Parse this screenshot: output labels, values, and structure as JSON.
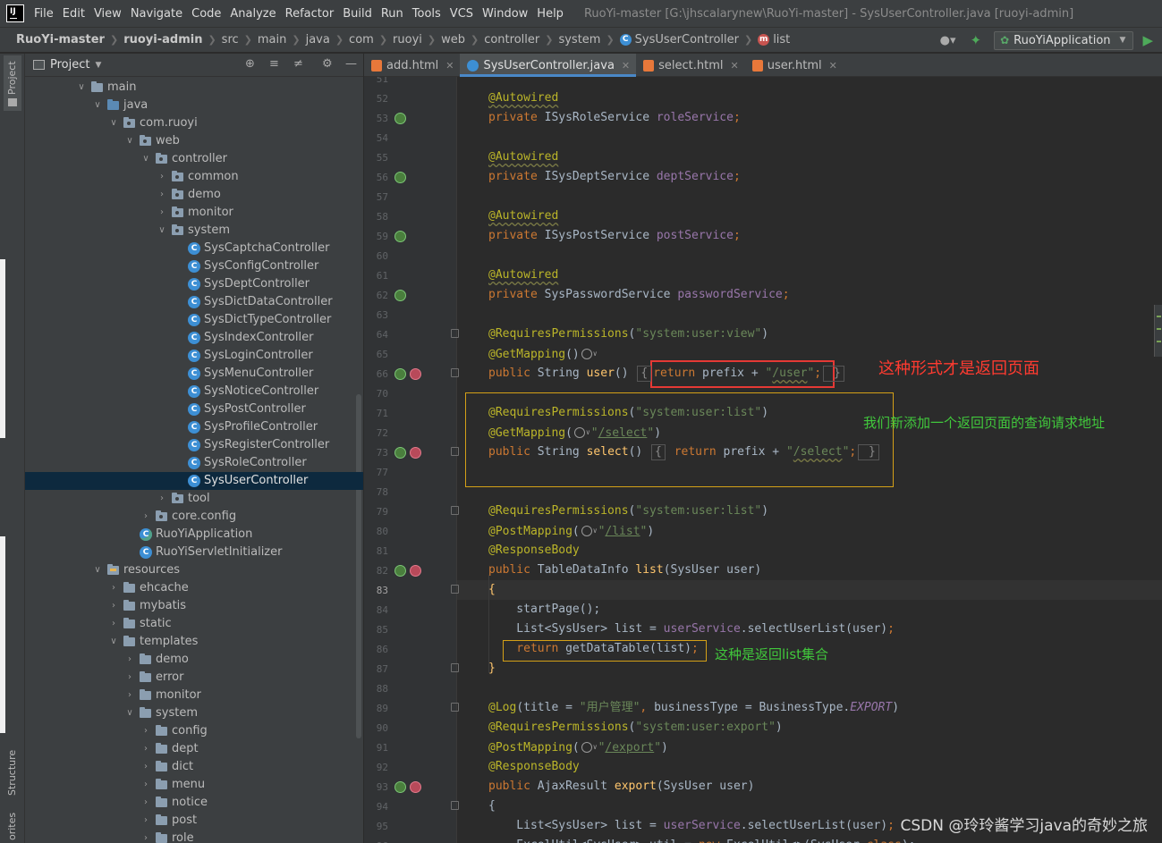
{
  "menubar": {
    "items": [
      "File",
      "Edit",
      "View",
      "Navigate",
      "Code",
      "Analyze",
      "Refactor",
      "Build",
      "Run",
      "Tools",
      "VCS",
      "Window",
      "Help"
    ],
    "window_title": "RuoYi-master [G:\\jhscalarynew\\RuoYi-master] - SysUserController.java [ruoyi-admin]"
  },
  "navbar": {
    "crumbs": [
      "RuoYi-master",
      "ruoyi-admin",
      "src",
      "main",
      "java",
      "com",
      "ruoyi",
      "web",
      "controller",
      "system",
      "SysUserController",
      "list"
    ],
    "run_config": "RuoYiApplication"
  },
  "stripe": {
    "project": "Project",
    "structure": "Structure",
    "favorites": "orites"
  },
  "project_panel": {
    "title": "Project",
    "tree": [
      {
        "label": "main",
        "depth": 0,
        "kind": "folder",
        "expanded": true
      },
      {
        "label": "java",
        "depth": 1,
        "kind": "src",
        "expanded": true
      },
      {
        "label": "com.ruoyi",
        "depth": 2,
        "kind": "pkg",
        "expanded": true
      },
      {
        "label": "web",
        "depth": 3,
        "kind": "pkg",
        "expanded": true
      },
      {
        "label": "controller",
        "depth": 4,
        "kind": "pkg",
        "expanded": true
      },
      {
        "label": "common",
        "depth": 5,
        "kind": "pkg",
        "expanded": false
      },
      {
        "label": "demo",
        "depth": 5,
        "kind": "pkg",
        "expanded": false
      },
      {
        "label": "monitor",
        "depth": 5,
        "kind": "pkg",
        "expanded": false
      },
      {
        "label": "system",
        "depth": 5,
        "kind": "pkg",
        "expanded": true
      },
      {
        "label": "SysCaptchaController",
        "depth": 6,
        "kind": "class"
      },
      {
        "label": "SysConfigController",
        "depth": 6,
        "kind": "class"
      },
      {
        "label": "SysDeptController",
        "depth": 6,
        "kind": "class"
      },
      {
        "label": "SysDictDataController",
        "depth": 6,
        "kind": "class"
      },
      {
        "label": "SysDictTypeController",
        "depth": 6,
        "kind": "class"
      },
      {
        "label": "SysIndexController",
        "depth": 6,
        "kind": "class"
      },
      {
        "label": "SysLoginController",
        "depth": 6,
        "kind": "class"
      },
      {
        "label": "SysMenuController",
        "depth": 6,
        "kind": "class"
      },
      {
        "label": "SysNoticeController",
        "depth": 6,
        "kind": "class"
      },
      {
        "label": "SysPostController",
        "depth": 6,
        "kind": "class"
      },
      {
        "label": "SysProfileController",
        "depth": 6,
        "kind": "class"
      },
      {
        "label": "SysRegisterController",
        "depth": 6,
        "kind": "class"
      },
      {
        "label": "SysRoleController",
        "depth": 6,
        "kind": "class"
      },
      {
        "label": "SysUserController",
        "depth": 6,
        "kind": "class",
        "selected": true
      },
      {
        "label": "tool",
        "depth": 5,
        "kind": "pkg",
        "expanded": false
      },
      {
        "label": "core.config",
        "depth": 4,
        "kind": "pkg",
        "expanded": false
      },
      {
        "label": "RuoYiApplication",
        "depth": 3,
        "kind": "spring"
      },
      {
        "label": "RuoYiServletInitializer",
        "depth": 3,
        "kind": "class"
      },
      {
        "label": "resources",
        "depth": 1,
        "kind": "res",
        "expanded": true
      },
      {
        "label": "ehcache",
        "depth": 2,
        "kind": "folder",
        "expanded": false
      },
      {
        "label": "mybatis",
        "depth": 2,
        "kind": "folder",
        "expanded": false
      },
      {
        "label": "static",
        "depth": 2,
        "kind": "folder",
        "expanded": false
      },
      {
        "label": "templates",
        "depth": 2,
        "kind": "folder",
        "expanded": true
      },
      {
        "label": "demo",
        "depth": 3,
        "kind": "folder",
        "expanded": false
      },
      {
        "label": "error",
        "depth": 3,
        "kind": "folder",
        "expanded": false
      },
      {
        "label": "monitor",
        "depth": 3,
        "kind": "folder",
        "expanded": false
      },
      {
        "label": "system",
        "depth": 3,
        "kind": "folder",
        "expanded": true
      },
      {
        "label": "config",
        "depth": 4,
        "kind": "folder",
        "expanded": false
      },
      {
        "label": "dept",
        "depth": 4,
        "kind": "folder",
        "expanded": false
      },
      {
        "label": "dict",
        "depth": 4,
        "kind": "folder",
        "expanded": false
      },
      {
        "label": "menu",
        "depth": 4,
        "kind": "folder",
        "expanded": false
      },
      {
        "label": "notice",
        "depth": 4,
        "kind": "folder",
        "expanded": false
      },
      {
        "label": "post",
        "depth": 4,
        "kind": "folder",
        "expanded": false
      },
      {
        "label": "role",
        "depth": 4,
        "kind": "folder",
        "expanded": false
      }
    ]
  },
  "tabs": [
    {
      "label": "add.html",
      "type": "html",
      "active": false
    },
    {
      "label": "SysUserController.java",
      "type": "java",
      "active": true
    },
    {
      "label": "select.html",
      "type": "html",
      "active": false
    },
    {
      "label": "user.html",
      "type": "html",
      "active": false
    }
  ],
  "editor": {
    "current_line": "83",
    "lines": [
      {
        "num": "51",
        "markers": [],
        "segs": []
      },
      {
        "num": "52",
        "markers": [],
        "segs": [
          {
            "t": "@Autowired",
            "c": "ann u-wavy"
          }
        ]
      },
      {
        "num": "53",
        "markers": [
          "run"
        ],
        "segs": [
          {
            "t": "private ",
            "c": "kw"
          },
          {
            "t": "ISysRoleService ",
            "c": "plain"
          },
          {
            "t": "roleService",
            "c": "fld"
          },
          {
            "t": ";",
            "c": "kw"
          }
        ]
      },
      {
        "num": "54",
        "markers": [],
        "segs": []
      },
      {
        "num": "55",
        "markers": [],
        "segs": [
          {
            "t": "@Autowired",
            "c": "ann u-wavy"
          }
        ]
      },
      {
        "num": "56",
        "markers": [
          "run"
        ],
        "segs": [
          {
            "t": "private ",
            "c": "kw"
          },
          {
            "t": "ISysDeptService ",
            "c": "plain"
          },
          {
            "t": "deptService",
            "c": "fld"
          },
          {
            "t": ";",
            "c": "kw"
          }
        ]
      },
      {
        "num": "57",
        "markers": [],
        "segs": []
      },
      {
        "num": "58",
        "markers": [],
        "segs": [
          {
            "t": "@Autowired",
            "c": "ann u-wavy"
          }
        ]
      },
      {
        "num": "59",
        "markers": [
          "run"
        ],
        "segs": [
          {
            "t": "private ",
            "c": "kw"
          },
          {
            "t": "ISysPostService ",
            "c": "plain"
          },
          {
            "t": "postService",
            "c": "fld"
          },
          {
            "t": ";",
            "c": "kw"
          }
        ]
      },
      {
        "num": "60",
        "markers": [],
        "segs": []
      },
      {
        "num": "61",
        "markers": [],
        "segs": [
          {
            "t": "@Autowired",
            "c": "ann u-wavy"
          }
        ]
      },
      {
        "num": "62",
        "markers": [
          "run"
        ],
        "segs": [
          {
            "t": "private ",
            "c": "kw"
          },
          {
            "t": "SysPasswordService ",
            "c": "plain"
          },
          {
            "t": "passwordService",
            "c": "fld"
          },
          {
            "t": ";",
            "c": "kw"
          }
        ]
      },
      {
        "num": "63",
        "markers": [],
        "segs": []
      },
      {
        "num": "64",
        "markers": [
          "fold"
        ],
        "segs": [
          {
            "t": "@RequiresPermissions",
            "c": "ann"
          },
          {
            "t": "(",
            "c": "plain"
          },
          {
            "t": "\"system:user:view\"",
            "c": "str"
          },
          {
            "t": ")",
            "c": "plain"
          }
        ]
      },
      {
        "num": "65",
        "markers": [],
        "segs": [
          {
            "t": "@GetMapping",
            "c": "ann"
          },
          {
            "t": "()",
            "c": "plain"
          },
          {
            "t": "globe",
            "c": "globe"
          }
        ]
      },
      {
        "num": "66",
        "markers": [
          "run",
          "web",
          "fold"
        ],
        "segs": [
          {
            "t": "public ",
            "c": "kw"
          },
          {
            "t": "String ",
            "c": "plain"
          },
          {
            "t": "user",
            "c": "fn"
          },
          {
            "t": "() ",
            "c": "plain"
          },
          {
            "t": "{",
            "c": "foldbox"
          },
          {
            "t": "return ",
            "c": "kw"
          },
          {
            "t": "prefix ",
            "c": "plain"
          },
          {
            "t": "+ ",
            "c": "plain"
          },
          {
            "t": "\"",
            "c": "str"
          },
          {
            "t": "/user",
            "c": "str u-wavy"
          },
          {
            "t": "\"",
            "c": "str"
          },
          {
            "t": ";",
            "c": "kw"
          },
          {
            "t": " }",
            "c": "foldbox"
          }
        ]
      },
      {
        "num": "70",
        "markers": [],
        "segs": []
      },
      {
        "num": "71",
        "markers": [],
        "segs": [
          {
            "t": "@RequiresPermissions",
            "c": "ann"
          },
          {
            "t": "(",
            "c": "plain"
          },
          {
            "t": "\"system:user:list\"",
            "c": "str"
          },
          {
            "t": ")",
            "c": "plain"
          }
        ]
      },
      {
        "num": "72",
        "markers": [],
        "segs": [
          {
            "t": "@GetMapping",
            "c": "ann"
          },
          {
            "t": "(",
            "c": "plain"
          },
          {
            "t": "globe",
            "c": "globe"
          },
          {
            "t": "\"",
            "c": "str"
          },
          {
            "t": "/select",
            "c": "str u-link"
          },
          {
            "t": "\"",
            "c": "str"
          },
          {
            "t": ")",
            "c": "plain"
          }
        ]
      },
      {
        "num": "73",
        "markers": [
          "run",
          "web",
          "fold"
        ],
        "segs": [
          {
            "t": "public ",
            "c": "kw"
          },
          {
            "t": "String ",
            "c": "plain"
          },
          {
            "t": "select",
            "c": "fn"
          },
          {
            "t": "() ",
            "c": "plain"
          },
          {
            "t": "{",
            "c": "foldbox"
          },
          {
            "t": " return ",
            "c": "kw"
          },
          {
            "t": "prefix ",
            "c": "plain"
          },
          {
            "t": "+ ",
            "c": "plain"
          },
          {
            "t": "\"",
            "c": "str"
          },
          {
            "t": "/select",
            "c": "str u-wavy"
          },
          {
            "t": "\"",
            "c": "str"
          },
          {
            "t": ";",
            "c": "kw"
          },
          {
            "t": " }",
            "c": "foldbox"
          }
        ]
      },
      {
        "num": "77",
        "markers": [],
        "segs": []
      },
      {
        "num": "78",
        "markers": [],
        "segs": []
      },
      {
        "num": "79",
        "markers": [
          "fold"
        ],
        "segs": [
          {
            "t": "@RequiresPermissions",
            "c": "ann"
          },
          {
            "t": "(",
            "c": "plain"
          },
          {
            "t": "\"system:user:list\"",
            "c": "str"
          },
          {
            "t": ")",
            "c": "plain"
          }
        ]
      },
      {
        "num": "80",
        "markers": [],
        "segs": [
          {
            "t": "@PostMapping",
            "c": "ann"
          },
          {
            "t": "(",
            "c": "plain"
          },
          {
            "t": "globe",
            "c": "globe"
          },
          {
            "t": "\"",
            "c": "str"
          },
          {
            "t": "/list",
            "c": "str u-link"
          },
          {
            "t": "\"",
            "c": "str"
          },
          {
            "t": ")",
            "c": "plain"
          }
        ]
      },
      {
        "num": "81",
        "markers": [],
        "segs": [
          {
            "t": "@ResponseBody",
            "c": "ann"
          }
        ]
      },
      {
        "num": "82",
        "markers": [
          "run",
          "web"
        ],
        "segs": [
          {
            "t": "public ",
            "c": "kw"
          },
          {
            "t": "TableDataInfo ",
            "c": "plain"
          },
          {
            "t": "list",
            "c": "fn"
          },
          {
            "t": "(SysUser user)",
            "c": "plain"
          }
        ]
      },
      {
        "num": "83",
        "markers": [
          "fold"
        ],
        "segs": [
          {
            "t": "{",
            "c": "fn"
          }
        ]
      },
      {
        "num": "84",
        "markers": [],
        "segs": [
          {
            "t": "    startPage();",
            "c": "plain"
          }
        ]
      },
      {
        "num": "85",
        "markers": [],
        "segs": [
          {
            "t": "    List<SysUser> list = ",
            "c": "plain"
          },
          {
            "t": "userService",
            "c": "fld"
          },
          {
            "t": ".selectUserList(user)",
            "c": "plain"
          },
          {
            "t": ";",
            "c": "kw"
          }
        ]
      },
      {
        "num": "86",
        "markers": [],
        "segs": [
          {
            "t": "    return ",
            "c": "kw"
          },
          {
            "t": "getDataTable(list)",
            "c": "plain"
          },
          {
            "t": ";",
            "c": "kw"
          }
        ]
      },
      {
        "num": "87",
        "markers": [
          "fold"
        ],
        "segs": [
          {
            "t": "}",
            "c": "fn"
          }
        ]
      },
      {
        "num": "88",
        "markers": [],
        "segs": []
      },
      {
        "num": "89",
        "markers": [
          "fold"
        ],
        "segs": [
          {
            "t": "@Log",
            "c": "ann"
          },
          {
            "t": "(title = ",
            "c": "plain"
          },
          {
            "t": "\"用户管理\"",
            "c": "str"
          },
          {
            "t": ", ",
            "c": "kw"
          },
          {
            "t": "businessType = BusinessType.",
            "c": "plain"
          },
          {
            "t": "EXPORT",
            "c": "fld it"
          },
          {
            "t": ")",
            "c": "plain"
          }
        ]
      },
      {
        "num": "90",
        "markers": [],
        "segs": [
          {
            "t": "@RequiresPermissions",
            "c": "ann"
          },
          {
            "t": "(",
            "c": "plain"
          },
          {
            "t": "\"system:user:export\"",
            "c": "str"
          },
          {
            "t": ")",
            "c": "plain"
          }
        ]
      },
      {
        "num": "91",
        "markers": [],
        "segs": [
          {
            "t": "@PostMapping",
            "c": "ann"
          },
          {
            "t": "(",
            "c": "plain"
          },
          {
            "t": "globe",
            "c": "globe"
          },
          {
            "t": "\"",
            "c": "str"
          },
          {
            "t": "/export",
            "c": "str u-link"
          },
          {
            "t": "\"",
            "c": "str"
          },
          {
            "t": ")",
            "c": "plain"
          }
        ]
      },
      {
        "num": "92",
        "markers": [],
        "segs": [
          {
            "t": "@ResponseBody",
            "c": "ann"
          }
        ]
      },
      {
        "num": "93",
        "markers": [
          "run",
          "web"
        ],
        "segs": [
          {
            "t": "public ",
            "c": "kw"
          },
          {
            "t": "AjaxResult ",
            "c": "plain"
          },
          {
            "t": "export",
            "c": "fn"
          },
          {
            "t": "(SysUser user)",
            "c": "plain"
          }
        ]
      },
      {
        "num": "94",
        "markers": [
          "fold"
        ],
        "segs": [
          {
            "t": "{",
            "c": "plain"
          }
        ]
      },
      {
        "num": "95",
        "markers": [],
        "segs": [
          {
            "t": "    List<SysUser> list = ",
            "c": "plain"
          },
          {
            "t": "userService",
            "c": "fld"
          },
          {
            "t": ".selectUserList(user)",
            "c": "plain"
          },
          {
            "t": ";",
            "c": "kw"
          }
        ]
      },
      {
        "num": "96",
        "markers": [],
        "segs": [
          {
            "t": "    ExcelUtil<SysUser> util = ",
            "c": "plain"
          },
          {
            "t": "new ",
            "c": "kw"
          },
          {
            "t": "ExcelUtil<>(SysUser.",
            "c": "plain"
          },
          {
            "t": "class",
            "c": "kw"
          },
          {
            "t": ");",
            "c": "plain"
          }
        ]
      }
    ]
  },
  "annotations": {
    "page_return_note": "这种形式才是返回页面",
    "new_request_note": "我们新添加一个返回页面的查询请求地址",
    "list_return_note": "这种是返回list集合"
  },
  "watermark": "CSDN @玲玲酱学习java的奇妙之旅"
}
